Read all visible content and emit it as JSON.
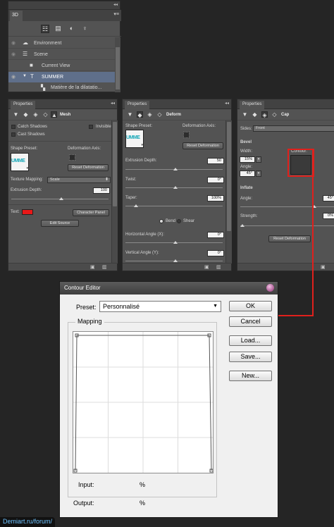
{
  "panel3d": {
    "tab": "3D",
    "items": [
      {
        "label": "Environment"
      },
      {
        "label": "Scene"
      },
      {
        "label": "Current View"
      },
      {
        "label": "SUMMER"
      },
      {
        "label": "Matière de la dilatatio..."
      }
    ]
  },
  "mesh_panel": {
    "tab": "Properties",
    "section": "Mesh",
    "catch_shadows": "Catch Shadows",
    "invisible": "Invisible",
    "cast_shadows": "Cast Shadows",
    "shape_preset": "Shape Preset:",
    "deformation_axis": "Deformation Axis:",
    "reset_deformation": "Reset Deformation",
    "texture_mapping_label": "Texture Mapping:",
    "texture_mapping_value": "Scale",
    "extrusion_depth_label": "Extrusion Depth:",
    "extrusion_depth_value": "100",
    "text_label": "Text:",
    "character_panel": "Character Panel",
    "edit_source": "Edit Source",
    "preset_thumb_text": "UMME"
  },
  "deform_panel": {
    "tab": "Properties",
    "section": "Deform",
    "shape_preset": "Shape Preset:",
    "deformation_axis": "Deformation Axis:",
    "reset_deformation": "Reset Deformation",
    "extrusion_depth_label": "Extrusion Depth:",
    "extrusion_depth_value": "50",
    "twist_label": "Twist:",
    "twist_value": "0°",
    "taper_label": "Taper:",
    "taper_value": "100%",
    "bend": "Bend",
    "shear": "Shear",
    "horizontal_angle_label": "Horizontal Angle (X):",
    "horizontal_angle_value": "0°",
    "vertical_angle_label": "Vertical Angle (Y):",
    "vertical_angle_value": "0°",
    "preset_thumb_text": "UMME"
  },
  "cap_panel": {
    "tab": "Properties",
    "section": "Cap",
    "sides_label": "Sides:",
    "sides_value": "Front",
    "bevel_heading": "Bevel",
    "width_label": "Width:",
    "width_value": "15%",
    "angle_label": "Angle:",
    "angle_value": "45°",
    "contour_label": "Contour:",
    "inflate_heading": "Inflate",
    "inflate_angle_label": "Angle:",
    "inflate_angle_value": "45°",
    "strength_label": "Strength:",
    "strength_value": "0%",
    "reset_deformation": "Reset Deformation"
  },
  "contour_editor": {
    "title": "Contour Editor",
    "preset_label": "Preset:",
    "preset_value": "Personnalisé",
    "mapping_label": "Mapping",
    "ok": "OK",
    "cancel": "Cancel",
    "load": "Load...",
    "save": "Save...",
    "new": "New...",
    "input_label": "Input:",
    "input_unit": "%",
    "output_label": "Output:",
    "output_unit": "%"
  },
  "watermark": "Demiart.ru/forum/",
  "colors": {
    "highlight": "#e0201c",
    "text_swatch": "#e81818",
    "selected_row": "#5f6f8a"
  }
}
